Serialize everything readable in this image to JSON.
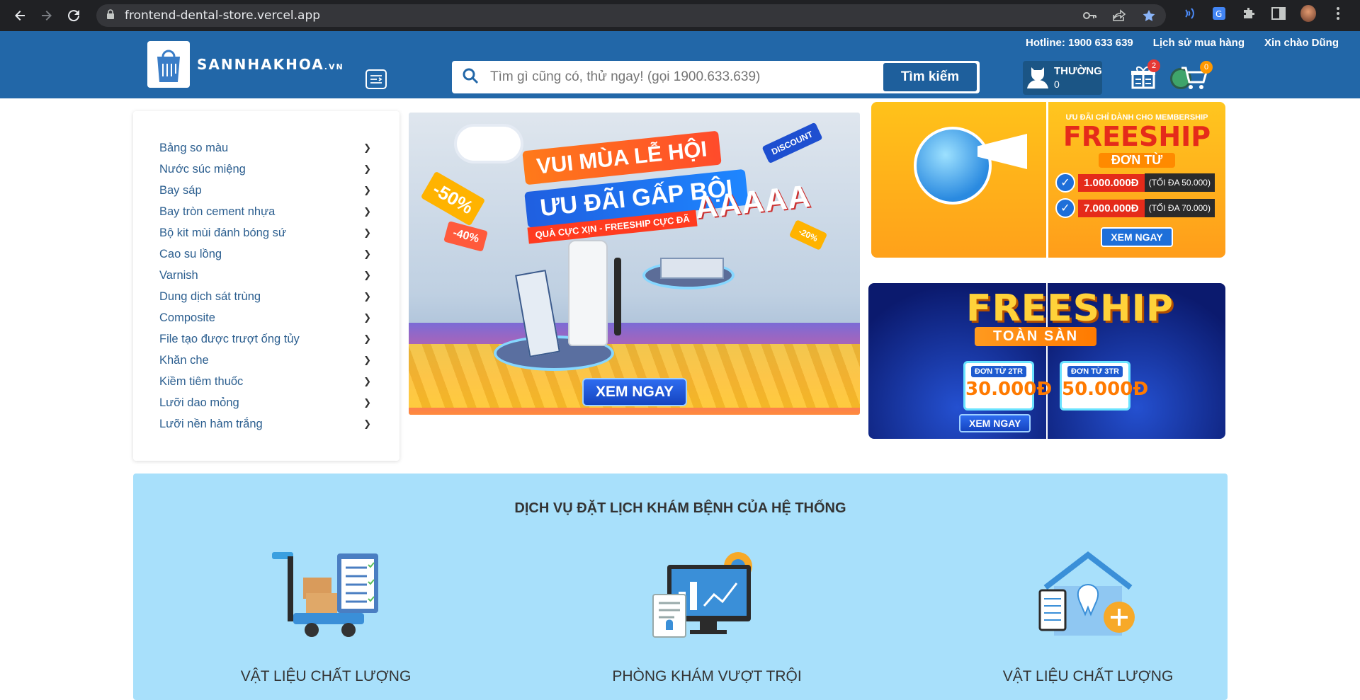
{
  "browser": {
    "url": "frontend-dental-store.vercel.app"
  },
  "header": {
    "hotline": "Hotline: 1900 633 639",
    "history": "Lịch sử mua hàng",
    "greeting": "Xin chào Dũng",
    "logo_main": "SANNHAKHOA",
    "logo_suffix": ".VN",
    "search_placeholder": "Tìm gì cũng có, thử ngay! (gọi 1900.633.639)",
    "search_button": "Tìm kiếm",
    "member_tier": "THƯỜNG",
    "member_points": "0",
    "gift_count": "2",
    "cart_count": "0"
  },
  "sidebar": {
    "categories": [
      "Bảng so màu",
      "Nước súc miệng",
      "Bay sáp",
      "Bay tròn cement nhựa",
      "Bộ kit mùi đánh bóng sứ",
      "Cao su lồng",
      "Varnish",
      "Dung dịch sát trùng",
      "Composite",
      "File tạo được trượt ống tủy",
      "Khăn che",
      "Kiềm tiêm thuốc",
      "Lưỡi dao mỏng",
      "Lưỡi nền hàm trắng"
    ]
  },
  "banner_main": {
    "title1": "VUI MÙA LỄ HỘI",
    "title2": "ƯU ĐÃI GẤP BỘI",
    "subtitle": "QUÀ CỰC XỊN - FREESHIP CỰC ĐÃ",
    "aaaa": "AAAAA",
    "tag1": "-50%",
    "tag2": "-40%",
    "tag3": "DISCOUNT",
    "tag4": "-20%",
    "cta": "XEM NGAY"
  },
  "banner_r1": {
    "small": "ƯU ĐÃI CHỈ DÀNH CHO MEMBERSHIP",
    "big": "FREESHIP",
    "from": "ĐƠN TỪ",
    "row1_amount": "1.000.000Đ",
    "row1_cap": "(TỐI ĐA 50.000)",
    "row2_amount": "7.000.000Đ",
    "row2_cap": "(TỐI ĐA 70.000)",
    "cta": "XEM NGAY"
  },
  "banner_r2": {
    "title": "FREESHIP",
    "subtitle": "TOÀN SÀN",
    "v1_label": "ĐƠN TỪ 2TR",
    "v1_amount": "30.000Đ",
    "v2_label": "ĐƠN TỪ 3TR",
    "v2_amount": "50.000Đ",
    "cta": "XEM NGAY"
  },
  "services": {
    "title": "DỊCH VỤ ĐẶT LỊCH KHÁM BỆNH CỦA HỆ THỐNG",
    "items": [
      {
        "label": "VẬT LIỆU CHẤT LƯỢNG",
        "icon": "delivery-trolley-icon"
      },
      {
        "label": "PHÒNG KHÁM VƯỢT TRỘI",
        "icon": "monitor-chart-icon"
      },
      {
        "label": "VẬT LIỆU CHẤT LƯỢNG",
        "icon": "dental-home-icon"
      }
    ]
  },
  "colors": {
    "header_blue": "#2267a8",
    "services_bg": "#a8e0fb",
    "badge_red": "#e53935",
    "badge_orange": "#ff9800"
  }
}
